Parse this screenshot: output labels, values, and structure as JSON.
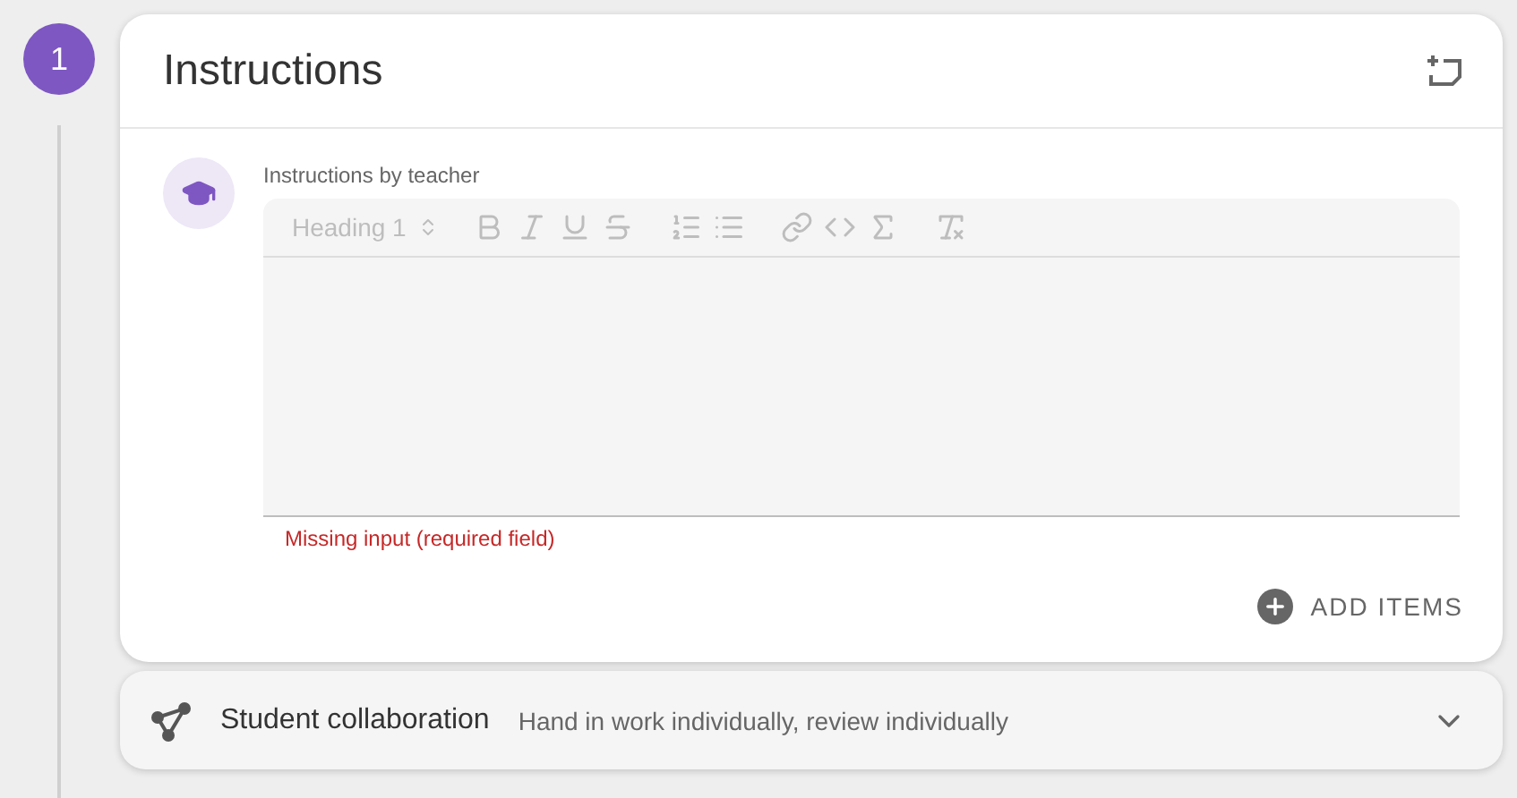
{
  "step": {
    "number": "1"
  },
  "instructions_card": {
    "title": "Instructions",
    "field_label": "Instructions by teacher",
    "editor": {
      "disabled": true,
      "heading_select": "Heading 1"
    },
    "error": "Missing input (required field)",
    "add_button": "ADD ITEMS"
  },
  "collaboration_card": {
    "title": "Student collaboration",
    "summary": "Hand in work individually, review individually",
    "expanded": false
  }
}
